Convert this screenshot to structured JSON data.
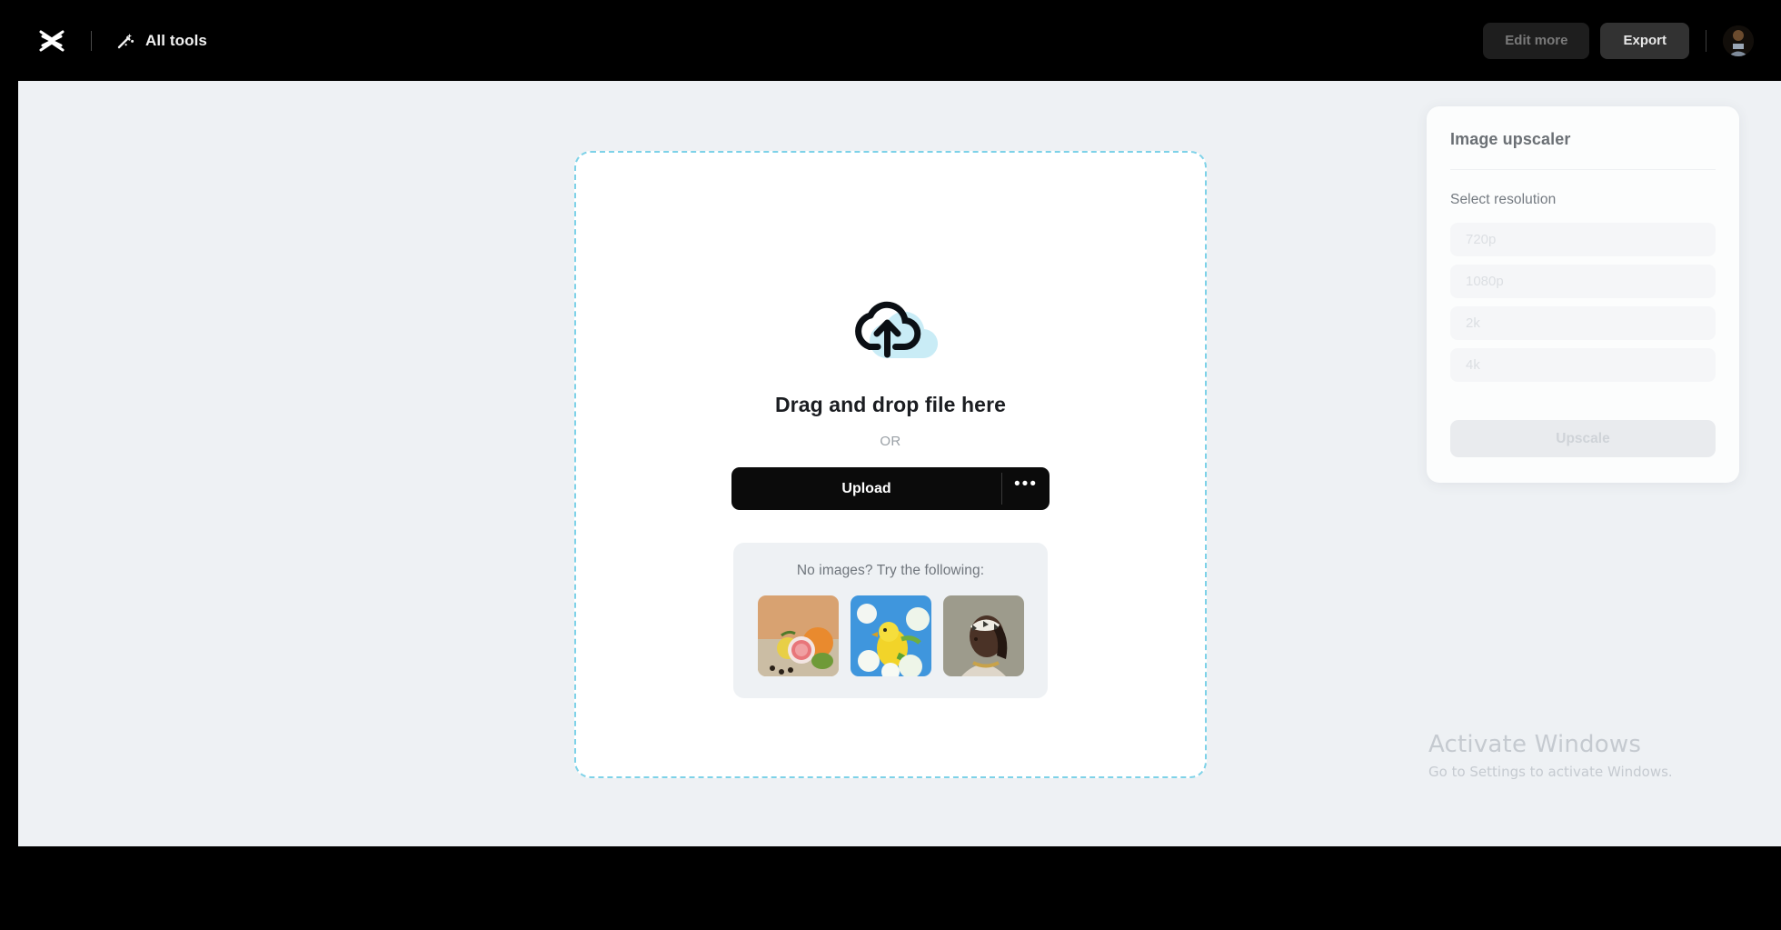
{
  "topbar": {
    "logo_icon": "capcut-logo-icon",
    "all_tools_icon": "magic-wand-icon",
    "all_tools_label": "All tools",
    "edit_more_label": "Edit more",
    "export_label": "Export",
    "avatar_icon": "user-avatar"
  },
  "dropzone": {
    "cloud_icon": "cloud-upload-icon",
    "title": "Drag and drop file here",
    "or_label": "OR",
    "upload_label": "Upload",
    "more_label": "•••",
    "samples": {
      "title": "No images? Try the following:",
      "items": [
        {
          "name": "sample-fruit",
          "alt": "Citrus fruit still life"
        },
        {
          "name": "sample-bird",
          "alt": "Yellow bird on blossoms"
        },
        {
          "name": "sample-portrait",
          "alt": "Woman with headwrap portrait"
        }
      ]
    }
  },
  "panel": {
    "title": "Image upscaler",
    "subtitle": "Select resolution",
    "resolutions": [
      {
        "label": "720p"
      },
      {
        "label": "1080p"
      },
      {
        "label": "2k"
      },
      {
        "label": "4k"
      }
    ],
    "upscale_label": "Upscale"
  },
  "watermark": {
    "line1": "Activate Windows",
    "line2": "Go to Settings to activate Windows."
  },
  "help": {
    "icon": "lightbulb-icon"
  },
  "colors": {
    "page_background": "#eef1f4",
    "topbar_background": "#000000",
    "dropzone_border": "#7ed2e8",
    "upload_button": "#0b0b0b",
    "cloud_accent": "#c9ecf6"
  }
}
